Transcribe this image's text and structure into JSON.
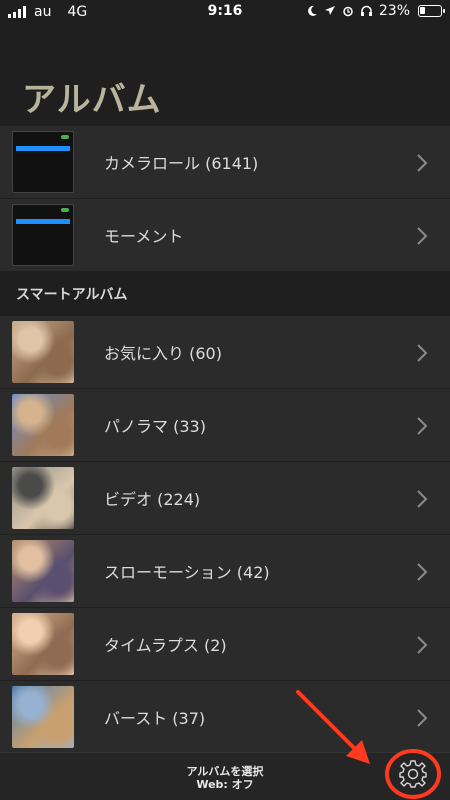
{
  "status_bar": {
    "carrier": "au",
    "network": "4G",
    "time": "9:16",
    "battery": "23%",
    "battery_level": 0.23
  },
  "page_title": "アルバム",
  "albums": [
    {
      "label": "カメラロール (6141)",
      "thumb": "screenshot"
    },
    {
      "label": "モーメント",
      "thumb": "screenshot"
    }
  ],
  "section_title": "スマートアルバム",
  "smart_albums": [
    {
      "label": "お気に入り (60)",
      "colors": [
        "#c9a98a",
        "#8b6a4d",
        "#e0c5a8"
      ]
    },
    {
      "label": "パノラマ (33)",
      "colors": [
        "#6b8fcc",
        "#a07a5a",
        "#d4b38d"
      ]
    },
    {
      "label": "ビデオ (224)",
      "colors": [
        "#8f8f8a",
        "#d9c6ac",
        "#4a4a48"
      ]
    },
    {
      "label": "スローモーション (42)",
      "colors": [
        "#b88f6a",
        "#5a4f6e",
        "#e0c0a0"
      ]
    },
    {
      "label": "タイムラプス (2)",
      "colors": [
        "#d7b08c",
        "#8e6b52",
        "#f0d0b0"
      ]
    },
    {
      "label": "バースト (37)",
      "colors": [
        "#4f7fb3",
        "#c8a070",
        "#96b2d2"
      ]
    }
  ],
  "bottom_bar": {
    "line1": "アルバムを選択",
    "line2": "Web: オフ"
  },
  "colors": {
    "title": "#b8b49c",
    "annotation": "#ff3b1f"
  },
  "icons": {
    "chevron": "chevron-right-icon",
    "settings": "gear-icon"
  }
}
